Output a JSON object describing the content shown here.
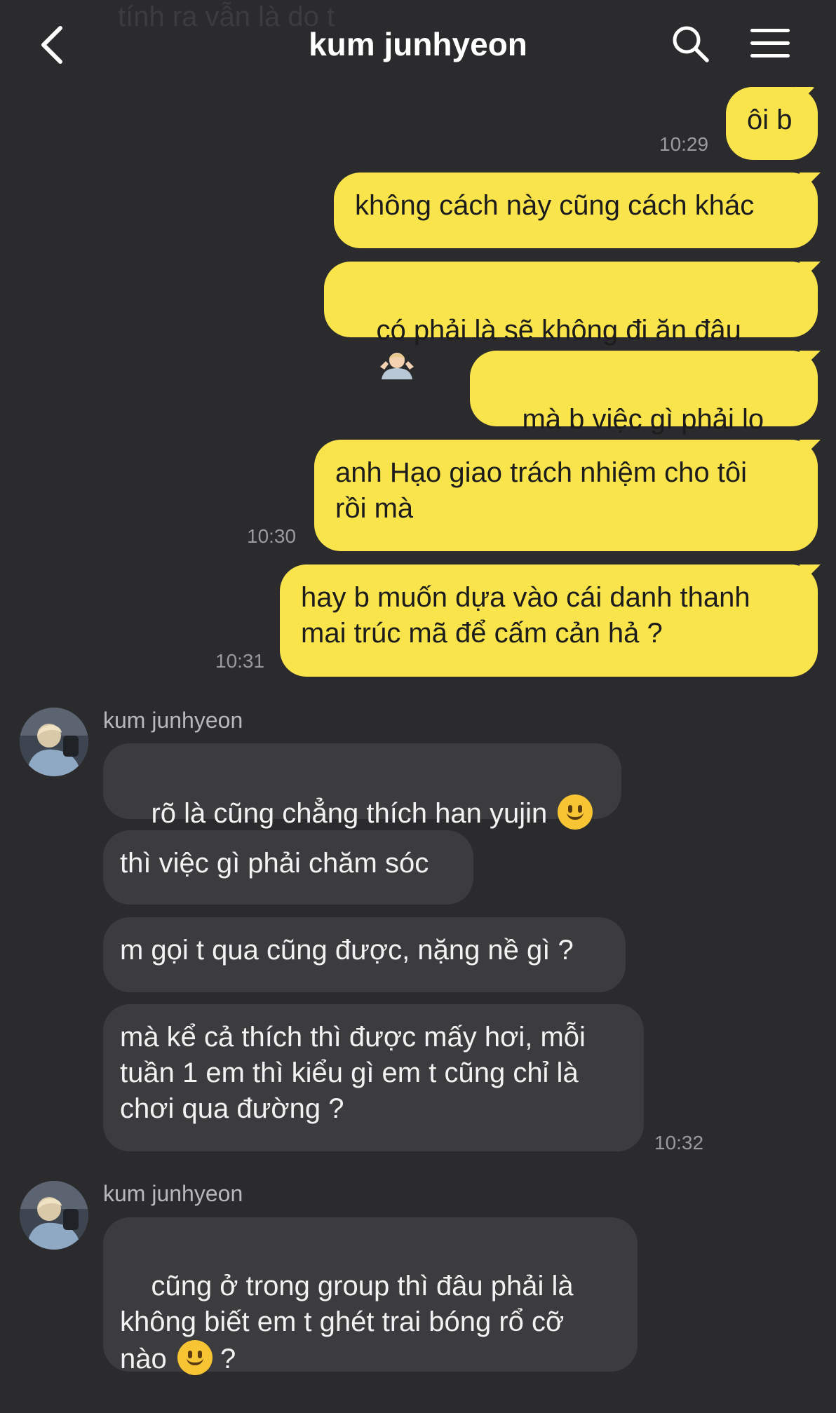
{
  "header": {
    "title": "kum junhyeon",
    "prev_message_faded": "tính ra vẫn là do t"
  },
  "messages": {
    "m1": {
      "text": "ôi b",
      "time": "10:29"
    },
    "m2": {
      "text": "không cách này cũng cách khác"
    },
    "m3": {
      "text": "có phải là sẽ không đi ăn đâu"
    },
    "m4": {
      "text": "mà b việc gì phải lo"
    },
    "m5": {
      "text": "anh Hạo giao trách nhiệm cho tôi\nrồi mà",
      "time": "10:30"
    },
    "m6": {
      "text": "hay b muốn dựa vào cái danh thanh\nmai trúc mã để cấm cản hả ?",
      "time": "10:31"
    },
    "g1": {
      "sender": "kum junhyeon",
      "b1": "rõ là cũng chẳng thích han yujin",
      "b2": "thì việc gì phải chăm sóc",
      "b3": "m gọi t qua cũng được, nặng nề gì ?",
      "b4": "mà kể cả thích thì được mấy hơi, mỗi\ntuần 1 em thì kiểu gì em t cũng chỉ là\nchơi qua đường ?",
      "time": "10:32"
    },
    "g2": {
      "sender": "kum junhyeon",
      "b1a": "cũng ở trong group thì đâu phải là\nkhông biết em t ghét trai bóng rổ cỡ\nnào",
      "b1b": "?"
    }
  },
  "icons": [
    "back-arrow-icon",
    "search-icon",
    "menu-icon",
    "smile-emoji",
    "person-shrugging-emoji"
  ],
  "colors": {
    "background": "#2b2b2d",
    "my_bubble": "#fae44c",
    "their_bubble": "#3c3c3f"
  }
}
